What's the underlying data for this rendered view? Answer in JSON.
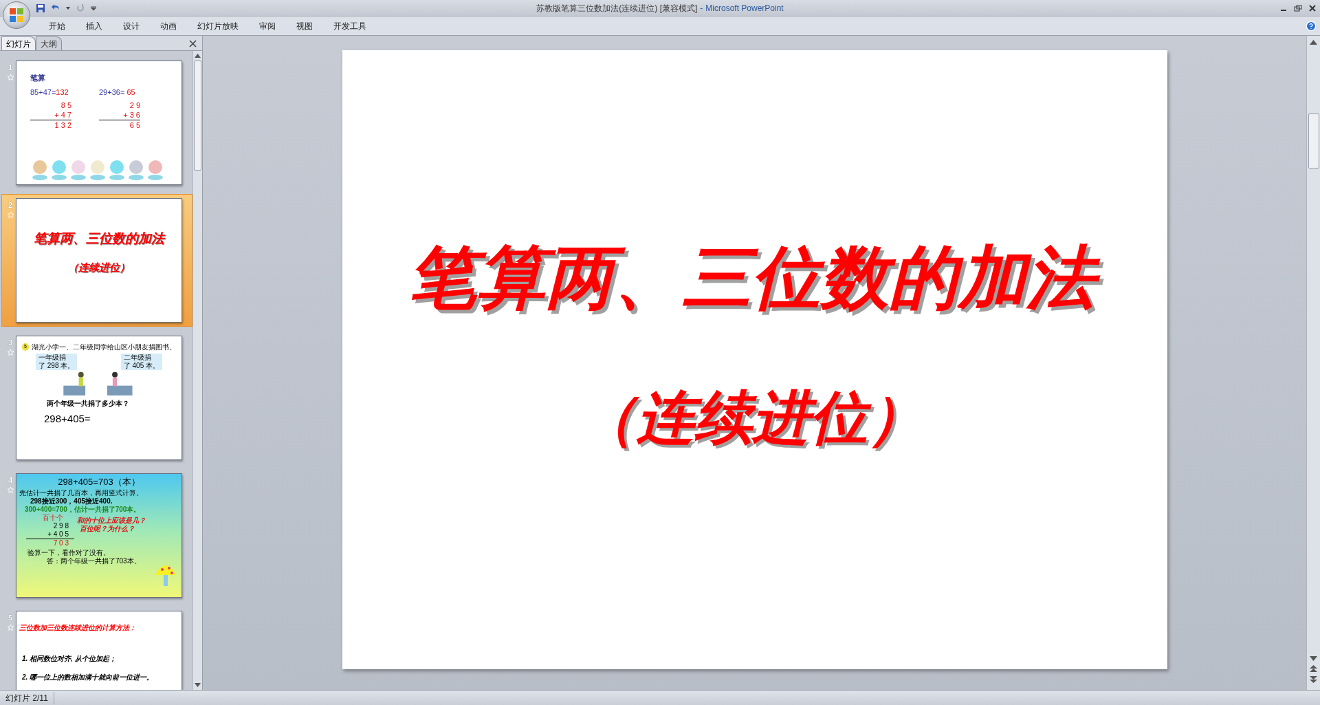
{
  "window": {
    "title": "苏教版笔算三位数加法(连续进位) [兼容模式]",
    "separator": "-",
    "app_name": "Microsoft PowerPoint"
  },
  "ribbon": {
    "tabs": [
      {
        "label": "开始"
      },
      {
        "label": "插入"
      },
      {
        "label": "设计"
      },
      {
        "label": "动画"
      },
      {
        "label": "幻灯片放映"
      },
      {
        "label": "审阅"
      },
      {
        "label": "视图"
      },
      {
        "label": "开发工具"
      }
    ]
  },
  "pane": {
    "tabs": [
      {
        "label": "幻灯片",
        "selected": true
      },
      {
        "label": "大纲",
        "selected": false
      }
    ],
    "slides": [
      {
        "number": "1",
        "selected": false,
        "kind": "arithmetic",
        "heading": "笔算",
        "sums": [
          {
            "expr": "85+47=",
            "result": "132",
            "rows": [
              "8 5",
              "+ 4 7",
              "1 3 2"
            ]
          },
          {
            "expr": "29+36=",
            "result": " 65",
            "rows": [
              "2 9",
              "+ 3 6",
              "6 5"
            ]
          }
        ]
      },
      {
        "number": "2",
        "selected": true,
        "kind": "title",
        "title": "笔算两、三位数的加法",
        "subtitle": "（连续进位）"
      },
      {
        "number": "3",
        "selected": false,
        "kind": "word_problem",
        "badge": "5",
        "caption": "湖光小学一、二年级同学给山区小朋友捐图书。",
        "bubbles": [
          [
            "一年级捐",
            "了 298 本。"
          ],
          [
            "二年级捐",
            "了 405 本。"
          ]
        ],
        "question": "两个年级一共捐了多少本？",
        "equation": "298+405="
      },
      {
        "number": "4",
        "selected": false,
        "kind": "solution",
        "header": "298+405=703（本）",
        "lines": [
          "先估计一共捐了几百本，再用竖式计算。",
          "298接近300，405接近400.",
          "300+400=700，估计一共捐了700本。"
        ],
        "places": "百十个",
        "rows": [
          "2 9 8",
          "+ 4 0 5",
          "7 0 3"
        ],
        "questions": [
          "和的十位上应该是几？",
          "百位呢？为什么？"
        ],
        "check": "验算一下，看作对了没有。",
        "answer": "答：两个年级一共捐了703本。"
      },
      {
        "number": "5",
        "selected": false,
        "kind": "method",
        "title": "三位数加三位数连续进位的计算方法：",
        "items": [
          "1. 相同数位对齐, 从个位加起；",
          "2. 哪一位上的数相加满十就向前一位进一。"
        ]
      }
    ]
  },
  "main_slide": {
    "title": "笔算两、三位数的加法",
    "subtitle": "（连续进位）"
  },
  "status_bar": {
    "slide_counter": "幻灯片 2/11"
  }
}
